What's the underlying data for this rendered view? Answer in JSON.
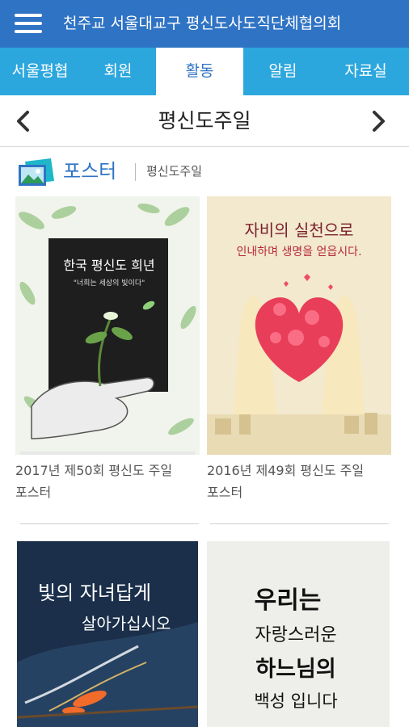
{
  "app": {
    "title": "천주교 서울대교구 평신도사도직단체협의회"
  },
  "tabs": [
    {
      "label": "서울평협",
      "active": false
    },
    {
      "label": "회원",
      "active": false
    },
    {
      "label": "활동",
      "active": true
    },
    {
      "label": "알림",
      "active": false
    },
    {
      "label": "자료실",
      "active": false
    }
  ],
  "subnav": {
    "title": "평신도주일",
    "prev_icon": "chevron-left-icon",
    "next_icon": "chevron-right-icon"
  },
  "section": {
    "title": "포스터",
    "subtitle": "평신도주일",
    "icon": "picture-icon"
  },
  "posters": [
    {
      "caption_line1": "2017년 제50회 평신도 주일",
      "caption_line2": "포스터",
      "art_heading": "한국 평신도 희년",
      "art_sub": "\"너희는 세상의 빛이다\""
    },
    {
      "caption_line1": "2016년 제49회 평신도 주일",
      "caption_line2": "포스터",
      "art_heading": "자비의 실천으로",
      "art_sub": "인내하며 생명을 얻읍시다."
    },
    {
      "art_heading": "빛의 자녀답게",
      "art_sub": "살아가십시오"
    },
    {
      "art_heading": "우리는",
      "art_sub": "자랑스러운",
      "art_sub2": "하느님의",
      "art_sub3": "백성 입니다"
    }
  ],
  "colors": {
    "header_blue": "#2f73c4",
    "tab_blue": "#2ca7de"
  }
}
